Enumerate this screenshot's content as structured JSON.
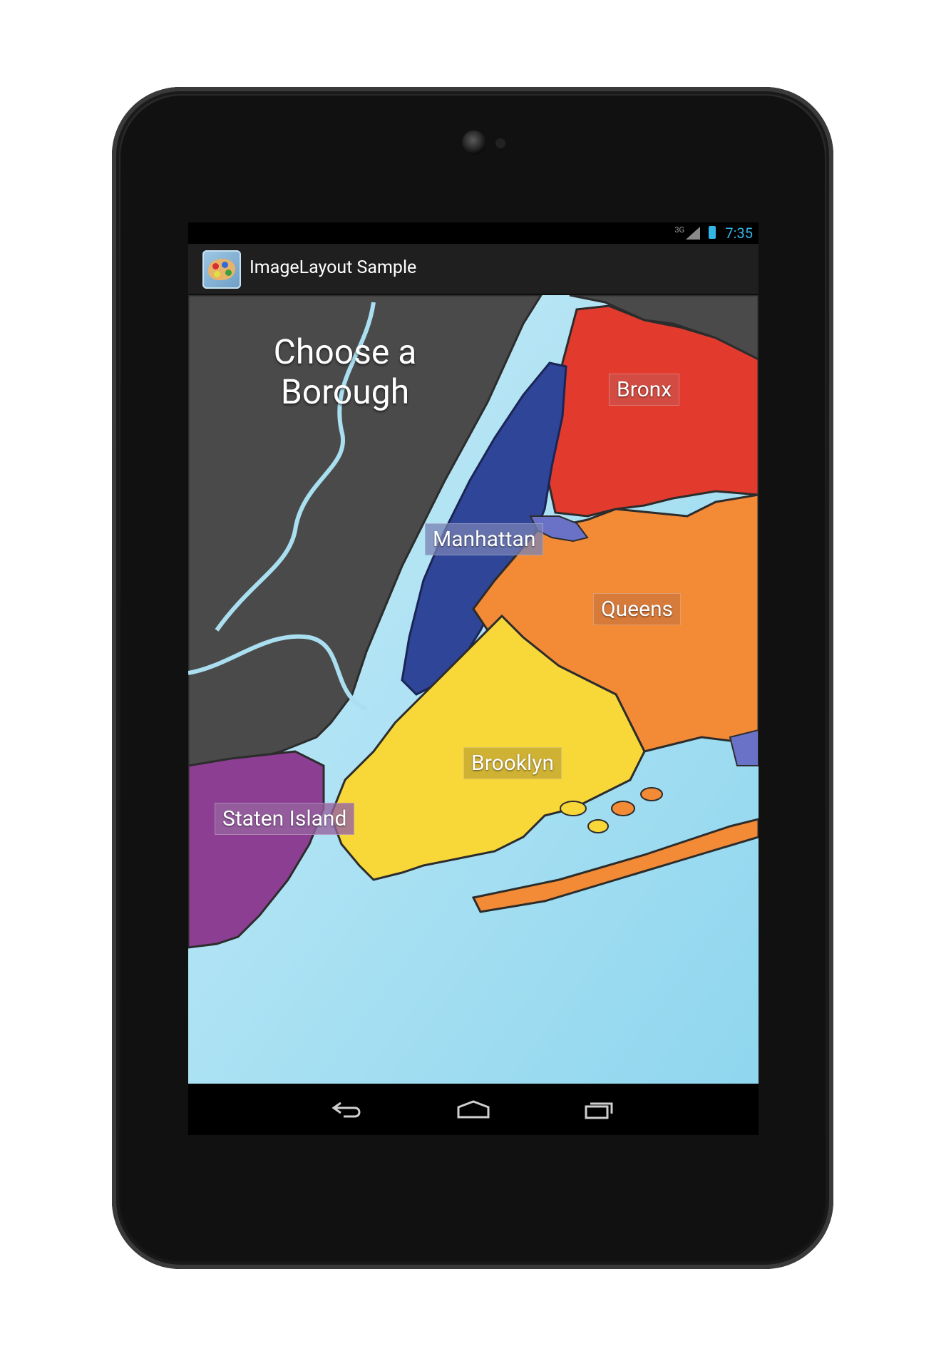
{
  "status_bar": {
    "network": "3G",
    "time": "7:35"
  },
  "action_bar": {
    "title": "ImageLayout Sample",
    "icon": "palette-icon"
  },
  "map": {
    "headline_line1": "Choose a",
    "headline_line2": "Borough",
    "boroughs": {
      "bronx": "Bronx",
      "manhattan": "Manhattan",
      "queens": "Queens",
      "brooklyn": "Brooklyn",
      "staten_island": "Staten Island"
    }
  },
  "nav_bar": {
    "back_icon": "back-icon",
    "home_icon": "home-icon",
    "recents_icon": "recent-apps-icon"
  },
  "colors": {
    "water": "#b9e6f5",
    "land_grey": "#4a4a4a",
    "bronx": "#e23b2e",
    "manhattan": "#2f4597",
    "queens": "#f28a36",
    "brooklyn": "#f8d838",
    "staten_island": "#8c3f92",
    "status_accent": "#33b5e5"
  }
}
